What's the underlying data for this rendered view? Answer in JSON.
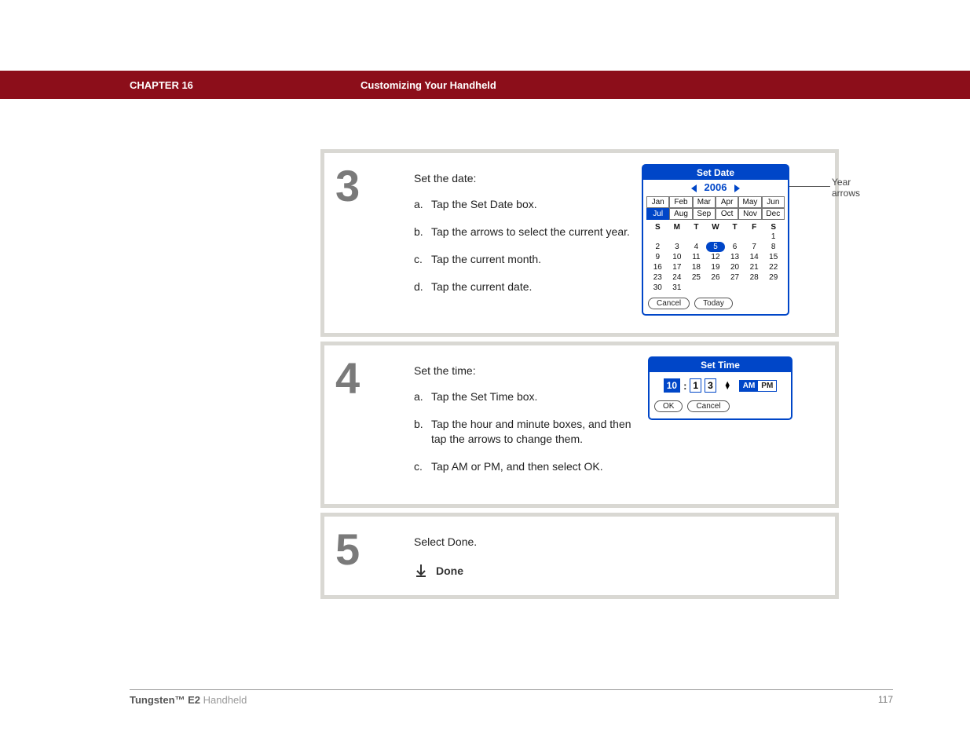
{
  "header": {
    "chapter": "CHAPTER 16",
    "title": "Customizing Your Handheld"
  },
  "steps": {
    "s3": {
      "number": "3",
      "lead": "Set the date:",
      "items": [
        {
          "lbl": "a.",
          "txt": "Tap the Set Date box."
        },
        {
          "lbl": "b.",
          "txt": "Tap the arrows to select the current year."
        },
        {
          "lbl": "c.",
          "txt": "Tap the current month."
        },
        {
          "lbl": "d.",
          "txt": "Tap the current date."
        }
      ],
      "dialog": {
        "title": "Set Date",
        "year": "2006",
        "months": [
          "Jan",
          "Feb",
          "Mar",
          "Apr",
          "May",
          "Jun",
          "Jul",
          "Aug",
          "Sep",
          "Oct",
          "Nov",
          "Dec"
        ],
        "selected_month": "Jul",
        "dow": [
          "S",
          "M",
          "T",
          "W",
          "T",
          "F",
          "S"
        ],
        "weeks": [
          [
            "",
            "",
            "",
            "",
            "",
            "",
            "1"
          ],
          [
            "2",
            "3",
            "4",
            "5",
            "6",
            "7",
            "8"
          ],
          [
            "9",
            "10",
            "11",
            "12",
            "13",
            "14",
            "15"
          ],
          [
            "16",
            "17",
            "18",
            "19",
            "20",
            "21",
            "22"
          ],
          [
            "23",
            "24",
            "25",
            "26",
            "27",
            "28",
            "29"
          ],
          [
            "30",
            "31",
            "",
            "",
            "",
            "",
            ""
          ]
        ],
        "selected_day": "5",
        "buttons": {
          "cancel": "Cancel",
          "today": "Today"
        }
      },
      "callout": "Year\narrows"
    },
    "s4": {
      "number": "4",
      "lead": "Set the time:",
      "items": [
        {
          "lbl": "a.",
          "txt": "Tap the Set Time box."
        },
        {
          "lbl": "b.",
          "txt": "Tap the hour and minute boxes, and then tap the arrows to change them."
        },
        {
          "lbl": "c.",
          "txt": "Tap AM or PM, and then select OK."
        }
      ],
      "dialog": {
        "title": "Set Time",
        "hour": "10",
        "min_tens": "1",
        "min_ones": "3",
        "am": "AM",
        "pm": "PM",
        "buttons": {
          "ok": "OK",
          "cancel": "Cancel"
        }
      }
    },
    "s5": {
      "number": "5",
      "lead": "Select Done.",
      "done": "Done"
    }
  },
  "footer": {
    "product_bold": "Tungsten™ E2",
    "product_light": " Handheld",
    "page": "117"
  }
}
